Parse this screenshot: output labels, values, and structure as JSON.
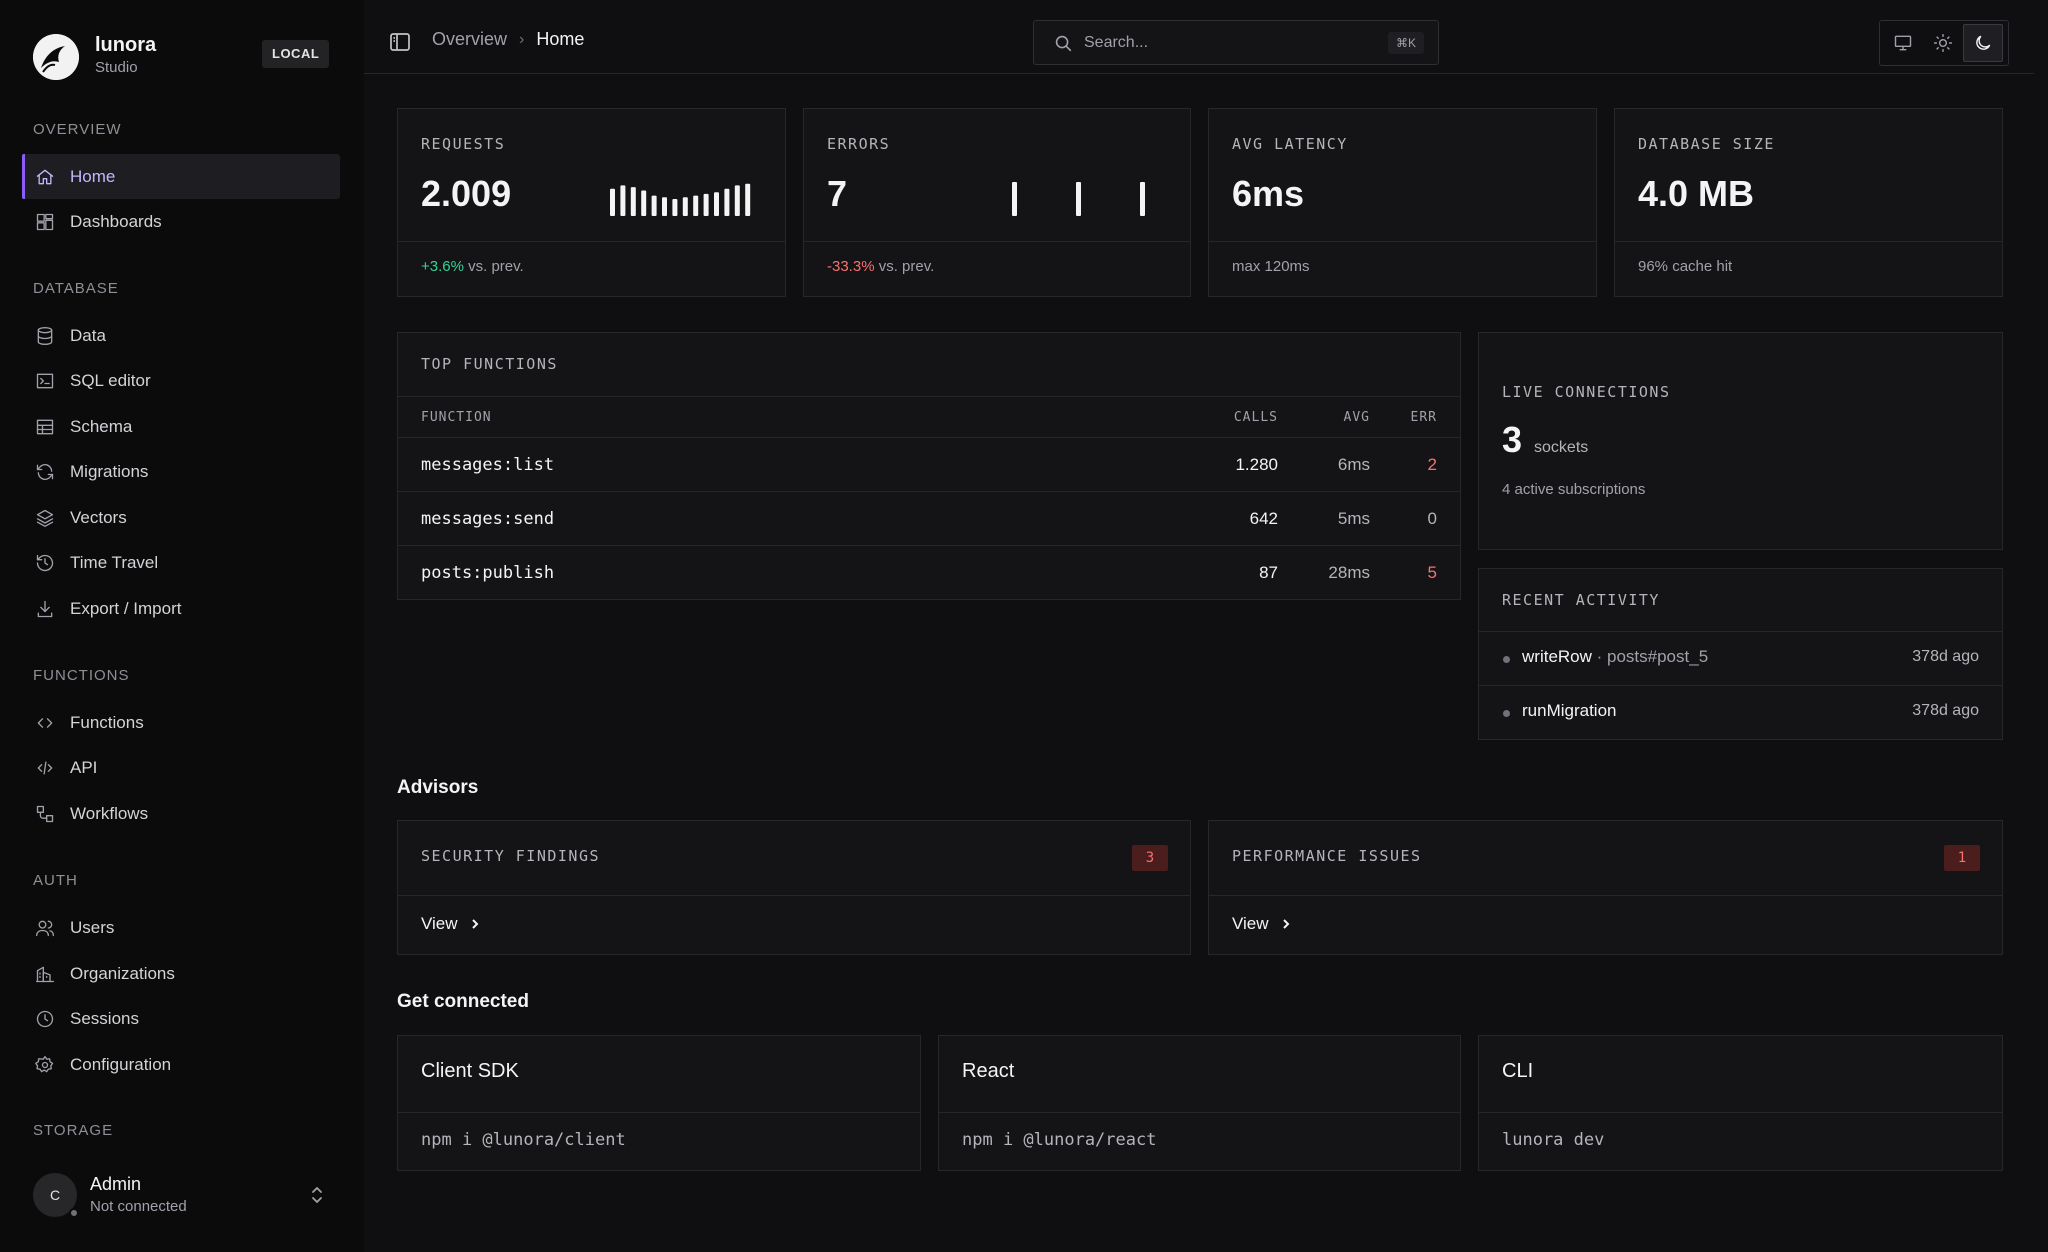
{
  "brand": {
    "name": "lunora",
    "subtitle": "Studio",
    "env": "LOCAL"
  },
  "nav": {
    "sections": {
      "overview": "OVERVIEW",
      "database": "DATABASE",
      "functions": "FUNCTIONS",
      "auth": "AUTH",
      "storage": "STORAGE"
    },
    "items": {
      "home": "Home",
      "dashboards": "Dashboards",
      "data": "Data",
      "sql_editor": "SQL editor",
      "schema": "Schema",
      "migrations": "Migrations",
      "vectors": "Vectors",
      "time_travel": "Time Travel",
      "export_import": "Export / Import",
      "functions": "Functions",
      "api": "API",
      "workflows": "Workflows",
      "users": "Users",
      "organizations": "Organizations",
      "sessions": "Sessions",
      "configuration": "Configuration"
    },
    "active": "home"
  },
  "user": {
    "initial": "C",
    "name": "Admin",
    "status": "Not connected"
  },
  "breadcrumb": {
    "parent": "Overview",
    "current": "Home"
  },
  "search": {
    "placeholder": "Search...",
    "shortcut": "⌘K"
  },
  "stats": {
    "requests": {
      "label": "REQUESTS",
      "value": "2.009",
      "delta": "+3.6%",
      "delta_suffix": " vs. prev.",
      "sparkline": [
        0.8,
        0.9,
        0.85,
        0.75,
        0.6,
        0.55,
        0.5,
        0.55,
        0.6,
        0.65,
        0.7,
        0.8,
        0.9,
        0.95
      ]
    },
    "errors": {
      "label": "ERRORS",
      "value": "7",
      "delta": "-33.3%",
      "delta_suffix": " vs. prev.",
      "sparkline": [
        1,
        1,
        1
      ]
    },
    "latency": {
      "label": "AVG LATENCY",
      "value": "6ms",
      "foot": "max 120ms"
    },
    "dbsize": {
      "label": "DATABASE SIZE",
      "value": "4.0 MB",
      "foot": "96% cache hit"
    }
  },
  "top_functions": {
    "title": "TOP FUNCTIONS",
    "headers": {
      "fn": "FUNCTION",
      "calls": "CALLS",
      "avg": "AVG",
      "err": "ERR"
    },
    "rows": [
      {
        "fn": "messages:list",
        "calls": "1.280",
        "avg": "6ms",
        "err": "2"
      },
      {
        "fn": "messages:send",
        "calls": "642",
        "avg": "5ms",
        "err": "0"
      },
      {
        "fn": "posts:publish",
        "calls": "87",
        "avg": "28ms",
        "err": "5"
      }
    ]
  },
  "live": {
    "title": "LIVE CONNECTIONS",
    "count": "3",
    "unit": "sockets",
    "sub": "4 active subscriptions"
  },
  "activity": {
    "title": "RECENT ACTIVITY",
    "items": [
      {
        "action": "writeRow",
        "target": " · posts#post_5",
        "time": "378d ago"
      },
      {
        "action": "runMigration",
        "target": "",
        "time": "378d ago"
      }
    ]
  },
  "advisors": {
    "title": "Advisors",
    "security": {
      "label": "SECURITY FINDINGS",
      "count": "3",
      "view": "View"
    },
    "performance": {
      "label": "PERFORMANCE ISSUES",
      "count": "1",
      "view": "View"
    }
  },
  "connect": {
    "title": "Get connected",
    "cards": [
      {
        "title": "Client SDK",
        "cmd": "npm i @lunora/client"
      },
      {
        "title": "React",
        "cmd": "npm i @lunora/react"
      },
      {
        "title": "CLI",
        "cmd": "lunora dev"
      }
    ]
  },
  "colors": {
    "accent": "#8b5cf6",
    "positive": "#34d399",
    "negative": "#f87171",
    "background": "#0f0f11",
    "card": "#141416"
  }
}
